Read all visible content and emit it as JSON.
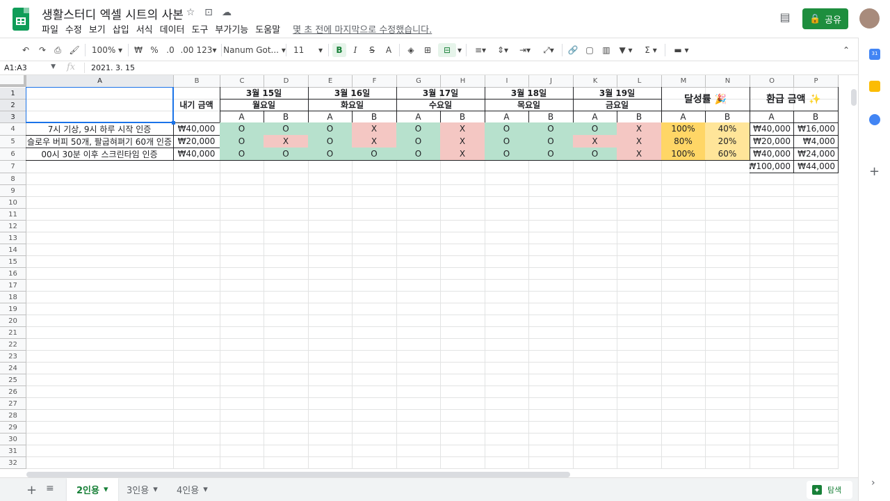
{
  "header": {
    "doc_title": "생활스터디 엑셀 시트의 사본",
    "title_icons": [
      "star-icon",
      "move-to-folder-icon",
      "cloud-status-icon"
    ],
    "menus": [
      "파일",
      "수정",
      "보기",
      "삽입",
      "서식",
      "데이터",
      "도구",
      "부가기능",
      "도움말"
    ],
    "last_edit": "몇 초 전에 마지막으로 수정했습니다.",
    "share_label": "공유",
    "colors": {
      "accent": "#1e8e3e",
      "brand": "#0f9d58"
    }
  },
  "toolbar": {
    "zoom": "100%",
    "currency": "₩",
    "percent": "%",
    "decimal_decrease": ".0",
    "decimal_increase": ".00",
    "number_format": "123",
    "font": "Nanum Got...",
    "font_size": "11",
    "bold": "B",
    "italic": "I",
    "strike": "S",
    "text_color": "A",
    "function": "Σ"
  },
  "formula_bar": {
    "name_box": "A1:A3",
    "fx": "fx",
    "value": "2021. 3. 15"
  },
  "columns": [
    "A",
    "B",
    "C",
    "D",
    "E",
    "F",
    "G",
    "H",
    "I",
    "J",
    "K",
    "L",
    "M",
    "N",
    "O",
    "P"
  ],
  "rows": [
    "1",
    "2",
    "3",
    "4",
    "5",
    "6",
    "7",
    "8",
    "9",
    "10",
    "11",
    "12",
    "13",
    "14",
    "15",
    "16",
    "17",
    "18",
    "19",
    "20",
    "21",
    "22",
    "23",
    "24",
    "25",
    "26",
    "27",
    "28",
    "29",
    "30",
    "31",
    "32"
  ],
  "sheet": {
    "b_header": "내기 금액",
    "dates": [
      "3월 15일",
      "3월 16일",
      "3월 17일",
      "3월 18일",
      "3월 19일"
    ],
    "days": [
      "월요일",
      "화요일",
      "수요일",
      "목요일",
      "금요일"
    ],
    "ab": [
      "A",
      "B"
    ],
    "achievement_header": "달성률 🎉",
    "refund_header": "환급 금액 ✨",
    "tasks": [
      {
        "name": "7시 기상, 9시 하루 시작 인증",
        "bet": "₩40,000",
        "marks": [
          "O",
          "O",
          "O",
          "X",
          "O",
          "X",
          "O",
          "O",
          "O",
          "X"
        ],
        "rate": [
          "100%",
          "40%"
        ],
        "refund": [
          "₩40,000",
          "₩16,000"
        ]
      },
      {
        "name": "슬로우 버피 50개, 팔굽혀펴기 60개 인증",
        "bet": "₩20,000",
        "marks": [
          "O",
          "X",
          "O",
          "X",
          "O",
          "X",
          "O",
          "O",
          "X",
          "X"
        ],
        "rate": [
          "80%",
          "20%"
        ],
        "refund": [
          "₩20,000",
          "₩4,000"
        ]
      },
      {
        "name": "00시 30분 이후 스크린타임 인증",
        "bet": "₩40,000",
        "marks": [
          "O",
          "O",
          "O",
          "O",
          "O",
          "X",
          "O",
          "O",
          "O",
          "X"
        ],
        "rate": [
          "100%",
          "60%"
        ],
        "refund": [
          "₩40,000",
          "₩24,000"
        ]
      }
    ],
    "totals": [
      "₩100,000",
      "₩44,000"
    ],
    "colors": {
      "o": "#b7e1cd",
      "x": "#f4c7c3",
      "rate_a": "#ffd666",
      "rate_b": "#ffe599"
    }
  },
  "tabs": {
    "sheets": [
      "2인용",
      "3인용",
      "4인용"
    ],
    "active": "2인용",
    "explore_label": "탐색"
  }
}
